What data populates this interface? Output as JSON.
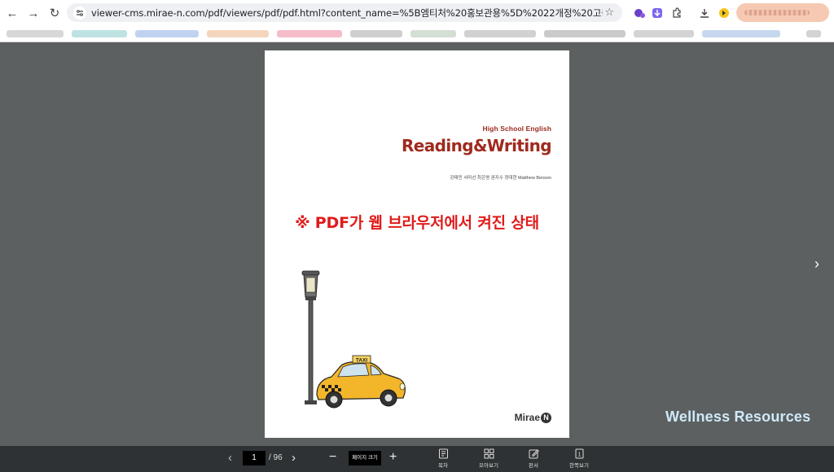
{
  "browser": {
    "url": "viewer-cms.mirae-n.com/pdf/viewers/pdf/pdf.html?content_name=%5B엠티처%20홍보관용%5D%2022개정%20고등%20영어%20독해와%20작문%2..."
  },
  "page": {
    "subtitle": "High School English",
    "title": "Reading&Writing",
    "authors": "강태민 서미선 최은영 권지수 정대현 Matthew Benson",
    "overlay_text": "※ PDF가 웹 브라우저에서 켜진 상태",
    "publisher": "Mirae",
    "publisher_mark": "N",
    "taxi_sign": "TAXI"
  },
  "watermark": "Wellness Resources",
  "toolbar": {
    "current_page": "1",
    "total_pages": "/ 96",
    "zoom_label": "페이지 크기",
    "toc_label": "목차",
    "thumbnails_label": "모아보기",
    "draw_label": "판서",
    "single_view_label": "한쪽보기",
    "single_view_icon_text": "1"
  },
  "colors": {
    "viewer_bg": "#5c6061",
    "toolbar_bg": "#2f3234",
    "title": "#a02a1e",
    "overlay": "#e01b1b",
    "watermark": "#cfe9f8"
  }
}
